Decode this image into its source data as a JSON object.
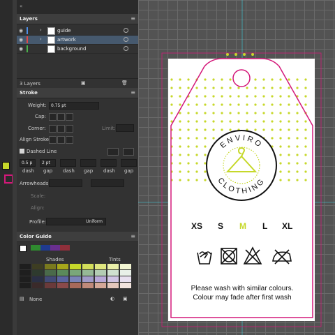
{
  "layers_panel": {
    "title": "Layers",
    "layers": [
      {
        "name": "guide",
        "color": "#4f8fe6"
      },
      {
        "name": "artwork",
        "color": "#e04848"
      },
      {
        "name": "background",
        "color": "#4ab04a"
      }
    ],
    "footer": "3 Layers"
  },
  "stroke_panel": {
    "title": "Stroke",
    "weight_label": "Weight:",
    "weight_value": "0.75 pt",
    "cap_label": "Cap:",
    "corner_label": "Corner:",
    "limit_label": "Limit:",
    "align_label": "Align Stroke:",
    "dashed_label": "Dashed Line",
    "dash1_value": "0.5 p",
    "gap1_value": "2 pt",
    "dash_label": "dash",
    "gap_label": "gap",
    "arrowheads_label": "Arrowheads:",
    "scale_label": "Scale:",
    "align_arrow_label": "Align:",
    "profile_label": "Profile:",
    "profile_value": "Uniform"
  },
  "color_guide_panel": {
    "title": "Color Guide",
    "shades_label": "Shades",
    "tints_label": "Tints",
    "none_label": "None",
    "harmony_colors": [
      "#2f8a2f",
      "#1f3a8f",
      "#6a2f8f",
      "#8f2f3a"
    ]
  },
  "tag": {
    "brand_top": "ENVIRO",
    "brand_bottom": "CLOTHING",
    "sizes": [
      "XS",
      "S",
      "M",
      "L",
      "XL"
    ],
    "highlight_size": "M",
    "accent_color": "#c6d82a",
    "outline_color": "#d4197a",
    "care_line1": "Please wash with similar colours.",
    "care_line2": "Colour may fade after first wash",
    "care_icons": [
      "hand-wash-icon",
      "no-tumble-dry-icon",
      "no-bleach-icon",
      "no-iron-icon"
    ]
  }
}
